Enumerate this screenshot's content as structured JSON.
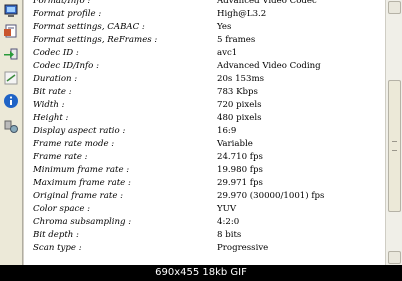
{
  "rows": [
    {
      "key": "Format/Info :",
      "value": "Advanced Video Codec"
    },
    {
      "key": "Format profile :",
      "value": "High@L3.2"
    },
    {
      "key": "Format settings, CABAC :",
      "value": "Yes"
    },
    {
      "key": "Format settings, ReFrames :",
      "value": "5 frames"
    },
    {
      "key": "Codec ID :",
      "value": "avc1"
    },
    {
      "key": "Codec ID/Info :",
      "value": "Advanced Video Coding"
    },
    {
      "key": "Duration :",
      "value": "20s 153ms"
    },
    {
      "key": "Bit rate :",
      "value": "783 Kbps"
    },
    {
      "key": "Width :",
      "value": "720 pixels"
    },
    {
      "key": "Height :",
      "value": "480 pixels"
    },
    {
      "key": "Display aspect ratio :",
      "value": "16:9"
    },
    {
      "key": "Frame rate mode :",
      "value": "Variable"
    },
    {
      "key": "Frame rate :",
      "value": "24.710 fps"
    },
    {
      "key": "Minimum frame rate :",
      "value": "19.980 fps"
    },
    {
      "key": "Maximum frame rate :",
      "value": "29.971 fps"
    },
    {
      "key": "Original frame rate :",
      "value": "29.970 (30000/1001) fps"
    },
    {
      "key": "Color space :",
      "value": "YUV"
    },
    {
      "key": "Chroma subsampling :",
      "value": "4:2:0"
    },
    {
      "key": "Bit depth :",
      "value": "8 bits"
    },
    {
      "key": "Scan type :",
      "value": "Progressive"
    }
  ],
  "caption": "690x455  18kb  GIF",
  "toolbar_icons": [
    "computer-icon",
    "sheet-icon",
    "import-icon",
    "chart-icon",
    "info-icon",
    "settings-icon"
  ],
  "colors": {
    "info_icon": "#1f63c6",
    "caption_bg": "#000000"
  }
}
